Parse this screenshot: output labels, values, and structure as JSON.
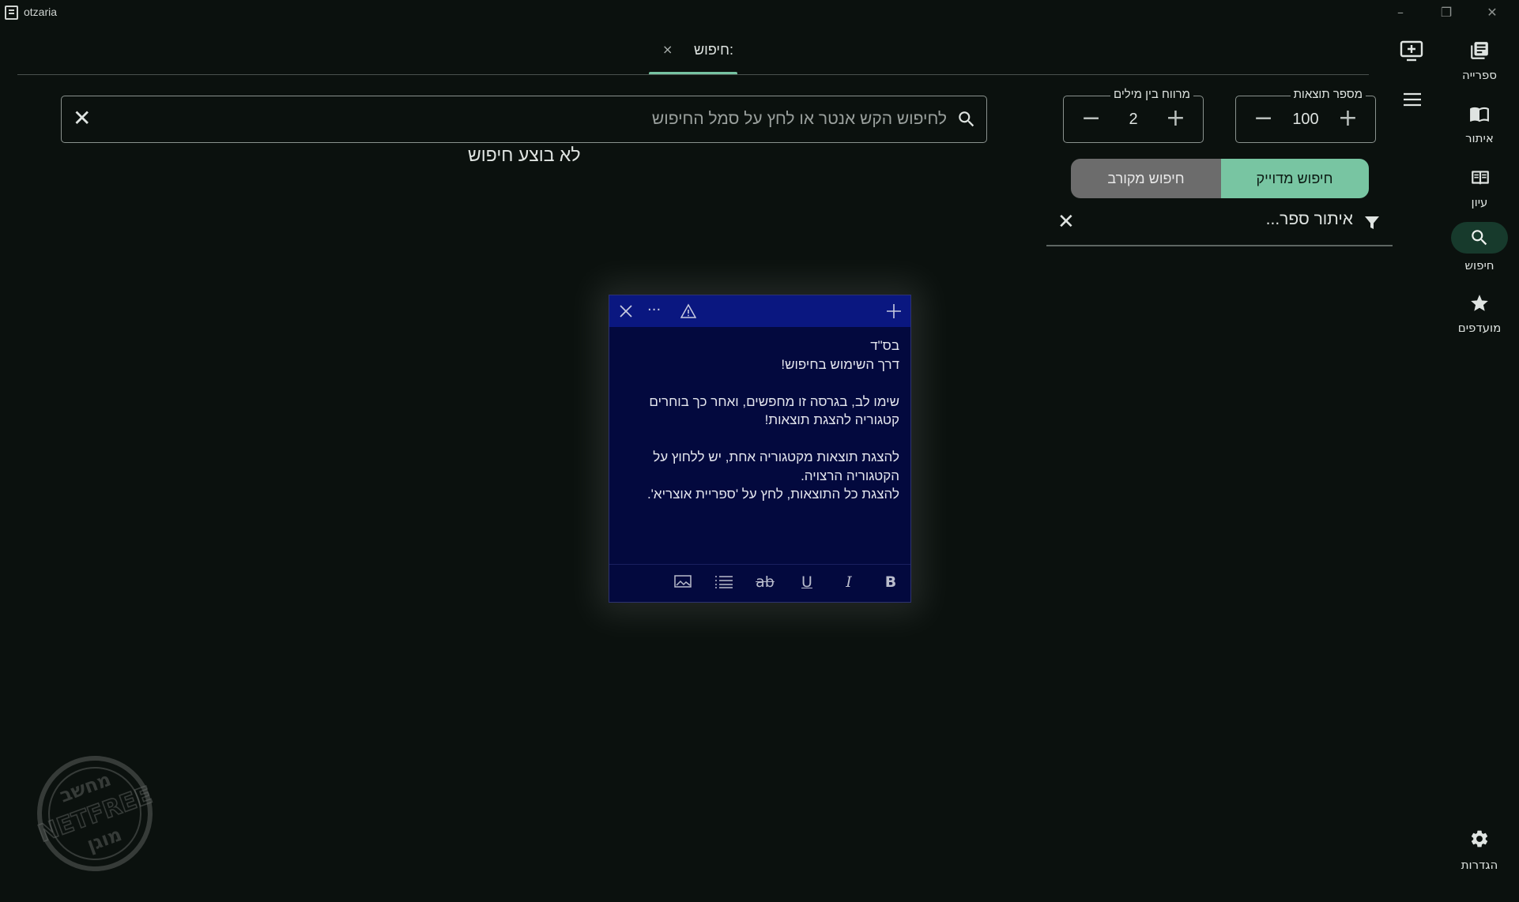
{
  "window": {
    "title": "otzaria"
  },
  "rail": {
    "items": [
      {
        "label": "ספרייה",
        "icon": "library-icon"
      },
      {
        "label": "איתור",
        "icon": "map-book-icon"
      },
      {
        "label": "עיון",
        "icon": "open-book-icon"
      },
      {
        "label": "חיפוש",
        "icon": "search-icon",
        "active": true
      },
      {
        "label": "מועדפים",
        "icon": "star-icon"
      }
    ],
    "settings_label": "הגדרות"
  },
  "tabs": [
    {
      "label": "חיפוש:",
      "close": "×"
    }
  ],
  "search": {
    "placeholder": "לחיפוש הקש אנטר או לחץ על סמל החיפוש",
    "clear": "✕",
    "status": "לא בוצע חיפוש"
  },
  "results_count": {
    "label": "מספר תוצאות",
    "value": "100"
  },
  "word_distance": {
    "label": "מרווח בין מילים",
    "value": "2"
  },
  "search_mode": {
    "exact": "חיפוש מדוייק",
    "approximate": "חיפוש מקורב",
    "selected": "exact"
  },
  "book_filter": {
    "placeholder": "איתור ספר...",
    "clear": "✕"
  },
  "note": {
    "lines": [
      "בס\"ד",
      "דרך השימוש בחיפוש!",
      "",
      "שימו לב, בגרסה זו מחפשים, ואחר כך בוחרים",
      "קטגוריה להצגת תוצאות!",
      "",
      "להצגת תוצאות מקטגוריה אחת, יש ללחוץ על",
      "הקטגוריה הרצויה.",
      "להצגת כל התוצאות, לחץ על 'ספריית אוצריא'."
    ],
    "toolbar": {
      "bold": "B",
      "italic": "I",
      "underline": "U",
      "strike": "ab"
    }
  },
  "watermark": {
    "top": "מחשב",
    "middle": "NETFREE",
    "bottom": "מוגן"
  },
  "colors": {
    "accent": "#78c5a2",
    "note_bg": "#03093e",
    "note_header": "#0a1780"
  }
}
